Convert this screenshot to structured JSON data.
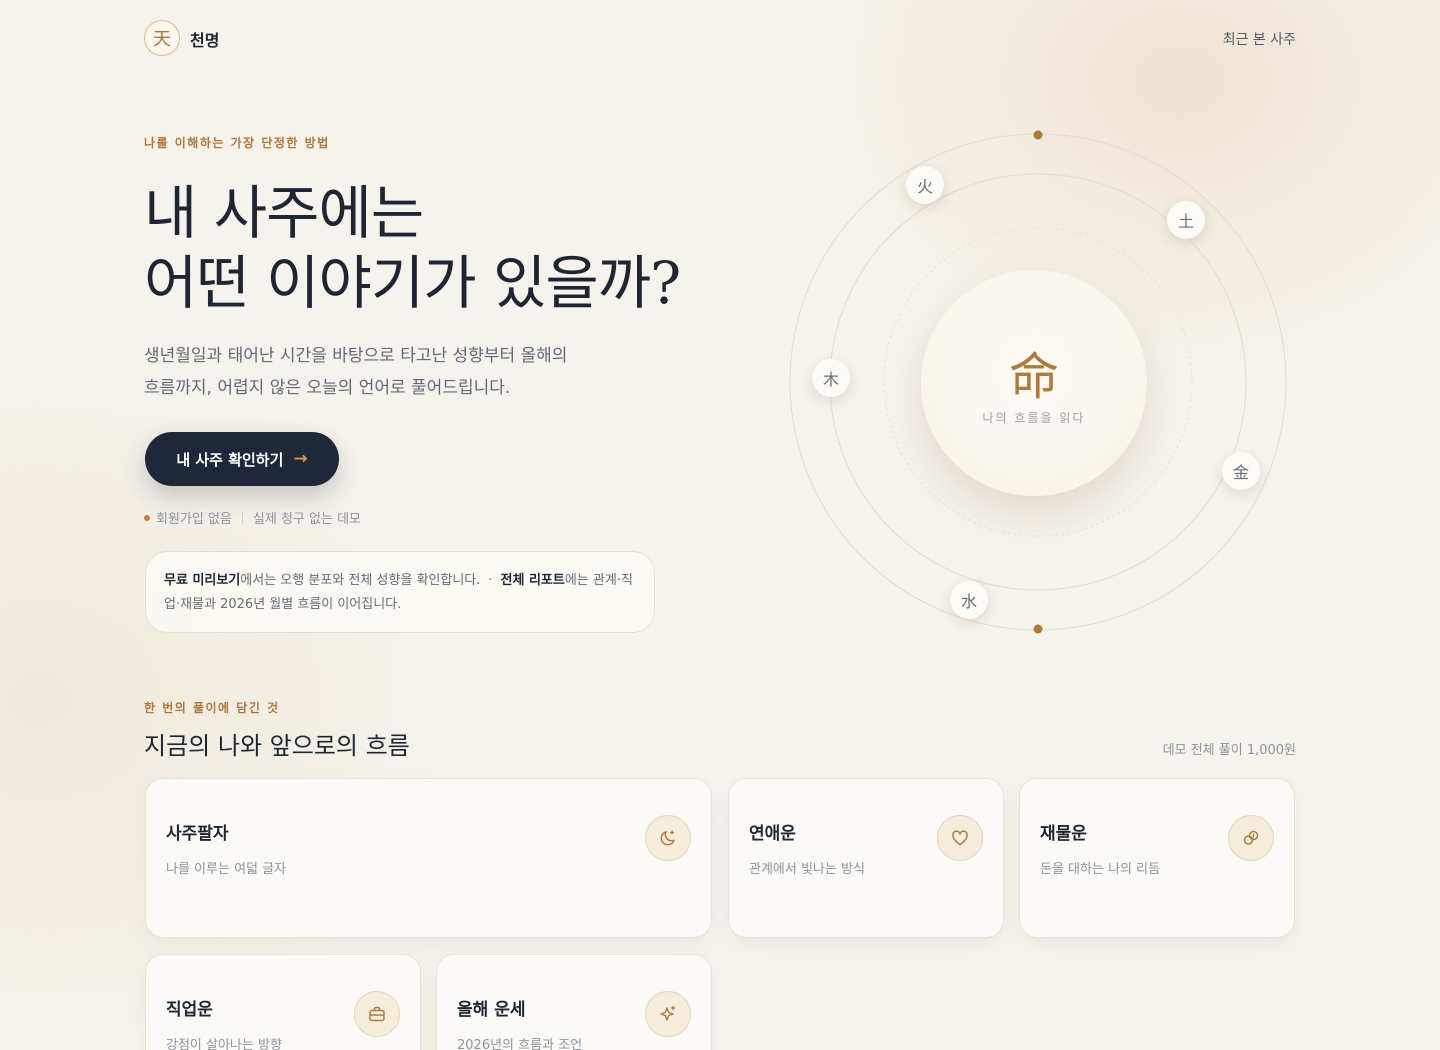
{
  "header": {
    "logo_char": "天",
    "brand": "천명",
    "nav_recent": "최근 본 사주"
  },
  "hero": {
    "eyebrow": "나를 이해하는 가장 단정한 방법",
    "title_line1": "내 사주에는",
    "title_line2": "어떤 이야기가 있을까?",
    "desc_line1": "생년월일과 태어난 시간을 바탕으로 타고난 성향부터 올해의",
    "desc_line2": "흐름까지, 어렵지 않은 오늘의 언어로 풀어드립니다.",
    "cta_label": "내 사주 확인하기",
    "cta_arrow": "→",
    "meta_1": "회원가입 없음",
    "meta_2": "실제 청구 없는 데모"
  },
  "info": {
    "free_bold": "무료 미리보기",
    "free_text": "에서는 오행 분포와 전체 성향을 확인합니다.",
    "separator": "·",
    "full_bold": "전체 리포트",
    "full_text": "에는 관계·직업·재물과 2026년 월별 흐름이 이어집니다."
  },
  "orbit": {
    "center_char": "命",
    "center_sub": "나의 흐름을 읽다",
    "elements": {
      "fire": "火",
      "earth": "土",
      "wood": "木",
      "metal": "金",
      "water": "水"
    }
  },
  "section": {
    "eyebrow": "한 번의 풀이에 담긴 것",
    "title": "지금의 나와 앞으로의 흐름",
    "price_note": "데모 전체 풀이 1,000원"
  },
  "cards": [
    {
      "title": "사주팔자",
      "sub": "나를 이루는 여덟 글자",
      "icon": "moon-icon"
    },
    {
      "title": "연애운",
      "sub": "관계에서 빛나는 방식",
      "icon": "heart-icon"
    },
    {
      "title": "재물운",
      "sub": "돈을 대하는 나의 리듬",
      "icon": "coins-icon"
    },
    {
      "title": "직업운",
      "sub": "강점이 살아나는 방향",
      "icon": "briefcase-icon"
    },
    {
      "title": "올해 운세",
      "sub": "2026년의 흐름과 조언",
      "icon": "sparkle-icon"
    }
  ],
  "colors": {
    "accent": "#b0773c",
    "navy": "#1e2838",
    "background": "#f6f3ec"
  }
}
